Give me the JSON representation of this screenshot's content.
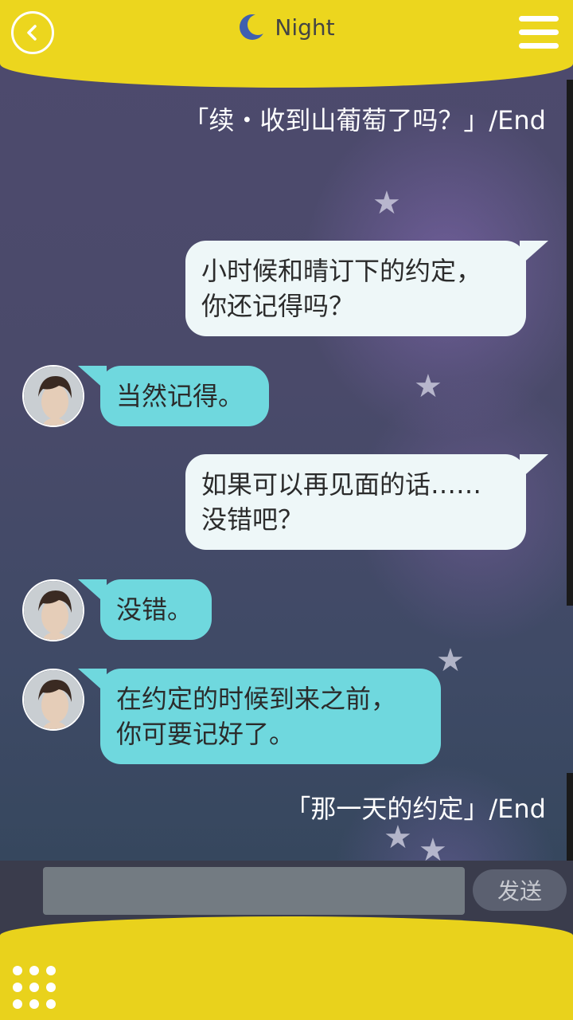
{
  "header": {
    "title": "Night",
    "accent_color": "#ecd61e",
    "icons": {
      "back": "chevron-left-icon",
      "theme": "crescent-moon-icon",
      "menu": "hamburger-menu-icon"
    }
  },
  "messages": [
    {
      "type": "end-label",
      "text": "「续・收到山葡萄了吗？」/End"
    },
    {
      "type": "bubble",
      "sender": "me",
      "lines": [
        "小时候和晴订下的约定，",
        "你还记得吗？"
      ]
    },
    {
      "type": "bubble",
      "sender": "them",
      "lines": [
        "当然记得。"
      ]
    },
    {
      "type": "bubble",
      "sender": "me",
      "lines": [
        "如果可以再见面的话……",
        "没错吧？"
      ]
    },
    {
      "type": "bubble",
      "sender": "them",
      "lines": [
        "没错。"
      ]
    },
    {
      "type": "bubble",
      "sender": "them",
      "lines": [
        "在约定的时候到来之前，",
        "你可要记好了。"
      ]
    },
    {
      "type": "end-label",
      "text": "「那一天的约定」/End"
    }
  ],
  "composer": {
    "input_value": "",
    "send_label": "发送"
  },
  "footer": {
    "menu_icon": "grid-dots-icon"
  }
}
